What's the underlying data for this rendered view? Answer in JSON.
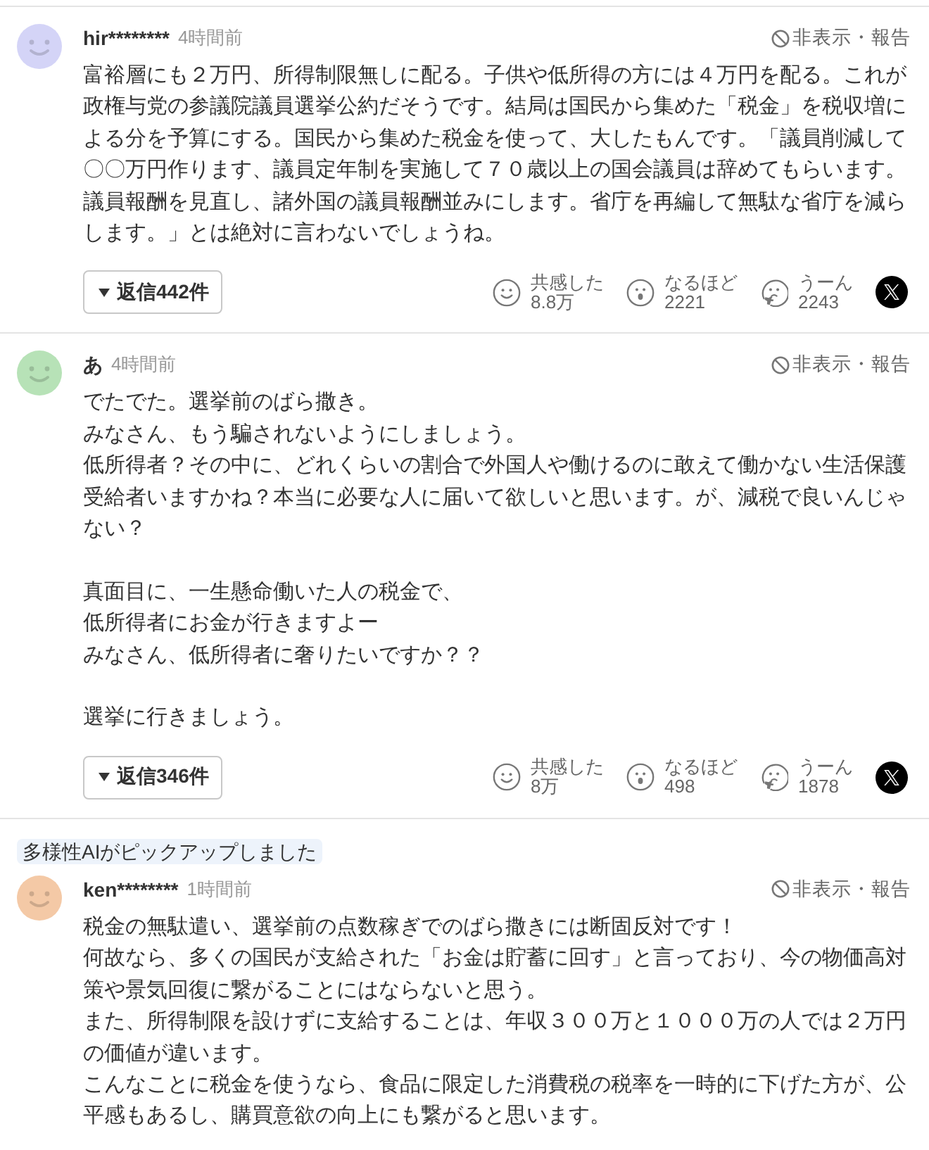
{
  "comments": [
    {
      "avatar": {
        "color": "#d4d4f7"
      },
      "user": "hir********",
      "time": "4時間前",
      "hide_report": "非表示・報告",
      "body": [
        [
          "富裕層にも２万円、所得制限無しに配る。子供や低所得の方には４万円を配る。これが政権与党の参議院議員選挙公約だそうです。結局は国民から集めた「税金」を税収増による分を予算にする。国民から集めた税金を使って、大したもんです。「議員削減して〇〇万円作ります、議員定年制を実施して７０歳以上の国会議員は辞めてもらいます。議員報酬を見直し、諸外国の議員報酬並みにします。省庁を再編して無駄な省庁を減らします。」とは絶対に言わないでしょうね。"
        ]
      ],
      "replies": "返信442件",
      "reactions": [
        {
          "kind": "empathy",
          "label": "共感した",
          "count": "8.8万"
        },
        {
          "kind": "insight",
          "label": "なるほど",
          "count": "2221"
        },
        {
          "kind": "doubt",
          "label": "うーん",
          "count": "2243"
        }
      ]
    },
    {
      "avatar": {
        "color": "#b7e2b7"
      },
      "user": "あ",
      "time": "4時間前",
      "hide_report": "非表示・報告",
      "body": [
        [
          "でたでた。選挙前のばら撒き。",
          "みなさん、もう騙されないようにしましょう。",
          "低所得者？その中に、どれくらいの割合で外国人や働けるのに敢えて働かない生活保護受給者いますかね？本当に必要な人に届いて欲しいと思います。が、減税で良いんじゃない？"
        ],
        [
          "真面目に、一生懸命働いた人の税金で、",
          "低所得者にお金が行きますよー",
          "みなさん、低所得者に奢りたいですか？？"
        ],
        [
          "選挙に行きましょう。"
        ]
      ],
      "replies": "返信346件",
      "reactions": [
        {
          "kind": "empathy",
          "label": "共感した",
          "count": "8万"
        },
        {
          "kind": "insight",
          "label": "なるほど",
          "count": "498"
        },
        {
          "kind": "doubt",
          "label": "うーん",
          "count": "1878"
        }
      ]
    },
    {
      "badge": "多様性AIがピックアップしました",
      "avatar": {
        "color": "#f4c9a6"
      },
      "user": "ken********",
      "time": "1時間前",
      "hide_report": "非表示・報告",
      "body": [
        [
          "税金の無駄遣い、選挙前の点数稼ぎでのばら撒きには断固反対です！",
          "何故なら、多くの国民が支給された「お金は貯蓄に回す」と言っており、今の物価高対策や景気回復に繋がることにはならないと思う。",
          "また、所得制限を設けずに支給することは、年収３００万と１０００万の人では２万円の価値が違います。",
          "こんなことに税金を使うなら、食品に限定した消費税の税率を一時的に下げた方が、公平感もあるし、購買意欲の向上にも繋がると思います。"
        ]
      ]
    }
  ]
}
